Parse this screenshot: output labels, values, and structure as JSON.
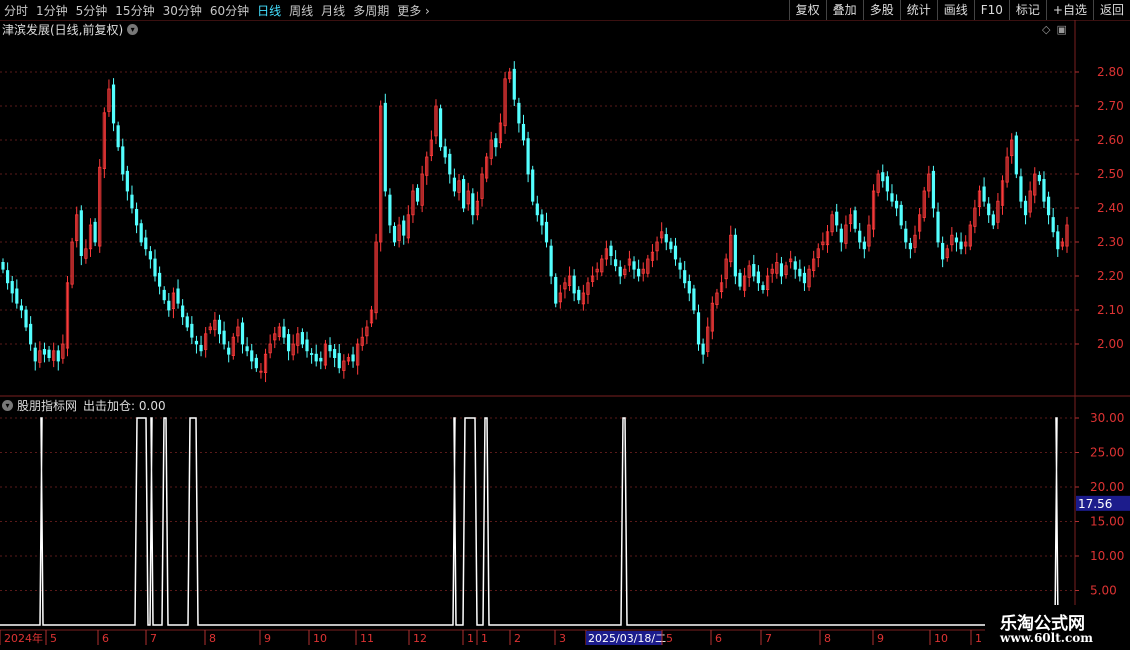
{
  "toolbar": {
    "timeframes": [
      "分时",
      "1分钟",
      "5分钟",
      "15分钟",
      "30分钟",
      "60分钟",
      "日线",
      "周线",
      "月线",
      "多周期",
      "更多"
    ],
    "selected": "日线",
    "right_buttons": [
      "复权",
      "叠加",
      "多股",
      "统计",
      "画线",
      "F10",
      "标记",
      "+自选",
      "返回"
    ]
  },
  "main_chart": {
    "title": "津滨发展(日线,前复权)",
    "price_ticks": [
      "2.80",
      "2.70",
      "2.60",
      "2.50",
      "2.40",
      "2.30",
      "2.20",
      "2.10",
      "2.00"
    ]
  },
  "indicator": {
    "title": "股朋指标网",
    "label": "出击加仓: 0.00",
    "ticks": [
      "30.00",
      "25.00",
      "20.00",
      "15.00",
      "10.00",
      "5.00"
    ],
    "highlight_value": "17.56"
  },
  "x_axis": {
    "labels": [
      "2024年",
      "5",
      "6",
      "7",
      "8",
      "9",
      "10",
      "11",
      "12",
      "1",
      "1",
      "2",
      "3",
      "2025/03/18/二",
      "5",
      "6",
      "7",
      "8",
      "9",
      "10",
      "1"
    ]
  },
  "watermark": {
    "line1": "乐淘公式网",
    "line2": "www.60lt.com"
  },
  "colors": {
    "up": "#ff3b3b",
    "down": "#54ffff",
    "grid": "#5a1a1a",
    "highlight_bg": "#1c1c8c"
  },
  "chart_data": {
    "type": "candlestick",
    "series_note": "approximate daily closes",
    "closes": [
      2.22,
      2.18,
      2.15,
      2.12,
      2.1,
      2.05,
      2.0,
      1.95,
      1.98,
      1.97,
      1.96,
      1.98,
      1.95,
      2.0,
      2.18,
      2.3,
      2.38,
      2.26,
      2.28,
      2.35,
      2.3,
      2.52,
      2.68,
      2.75,
      2.65,
      2.58,
      2.5,
      2.45,
      2.4,
      2.35,
      2.3,
      2.28,
      2.25,
      2.2,
      2.17,
      2.13,
      2.1,
      2.15,
      2.12,
      2.08,
      2.05,
      2.02,
      2.0,
      1.98,
      2.03,
      2.05,
      2.07,
      2.03,
      2.0,
      1.97,
      2.02,
      2.05,
      2.0,
      1.98,
      1.95,
      1.93,
      1.92,
      1.97,
      2.0,
      2.03,
      2.05,
      2.02,
      1.98,
      2.0,
      2.03,
      2.0,
      1.98,
      1.97,
      1.95,
      1.95,
      2.0,
      1.98,
      1.96,
      1.93,
      1.95,
      1.96,
      1.95,
      2.0,
      2.02,
      2.05,
      2.1,
      2.3,
      2.7,
      2.45,
      2.35,
      2.3,
      2.35,
      2.32,
      2.38,
      2.45,
      2.42,
      2.5,
      2.55,
      2.6,
      2.7,
      2.58,
      2.55,
      2.5,
      2.45,
      2.48,
      2.4,
      2.45,
      2.38,
      2.42,
      2.5,
      2.55,
      2.6,
      2.58,
      2.65,
      2.78,
      2.8,
      2.72,
      2.65,
      2.6,
      2.5,
      2.42,
      2.38,
      2.35,
      2.3,
      2.2,
      2.12,
      2.15,
      2.18,
      2.2,
      2.15,
      2.13,
      2.15,
      2.18,
      2.2,
      2.22,
      2.25,
      2.28,
      2.26,
      2.23,
      2.2,
      2.22,
      2.25,
      2.22,
      2.2,
      2.22,
      2.25,
      2.27,
      2.3,
      2.33,
      2.3,
      2.28,
      2.25,
      2.22,
      2.18,
      2.15,
      2.1,
      2.0,
      1.97,
      2.05,
      2.12,
      2.15,
      2.18,
      2.25,
      2.32,
      2.2,
      2.17,
      2.2,
      2.23,
      2.2,
      2.18,
      2.16,
      2.2,
      2.22,
      2.24,
      2.2,
      2.23,
      2.25,
      2.22,
      2.2,
      2.18,
      2.22,
      2.25,
      2.28,
      2.3,
      2.33,
      2.38,
      2.35,
      2.3,
      2.35,
      2.38,
      2.34,
      2.3,
      2.28,
      2.35,
      2.45,
      2.5,
      2.48,
      2.45,
      2.42,
      2.4,
      2.35,
      2.3,
      2.28,
      2.32,
      2.38,
      2.45,
      2.5,
      2.4,
      2.3,
      2.25,
      2.28,
      2.32,
      2.3,
      2.28,
      2.3,
      2.35,
      2.4,
      2.45,
      2.42,
      2.38,
      2.35,
      2.42,
      2.48,
      2.55,
      2.6,
      2.5,
      2.42,
      2.38,
      2.45,
      2.5,
      2.48,
      2.42,
      2.38,
      2.33,
      2.28,
      2.3,
      2.35
    ]
  }
}
